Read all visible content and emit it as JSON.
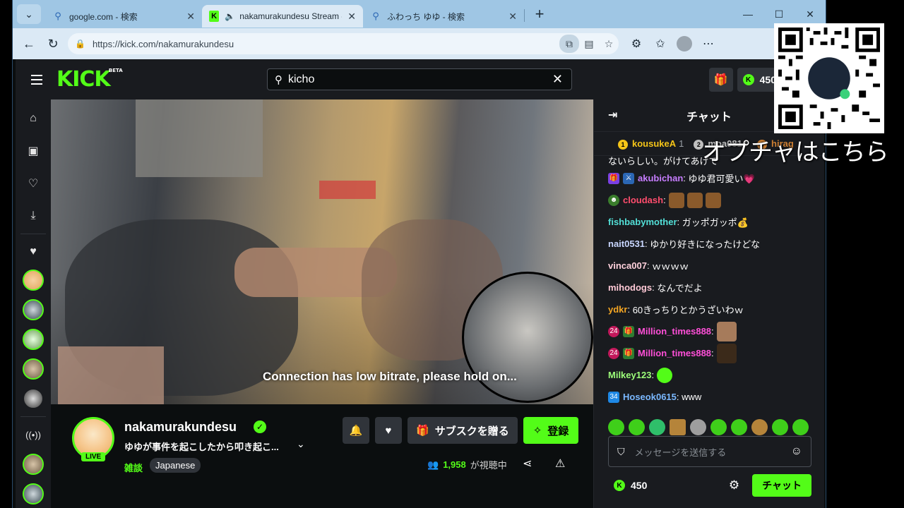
{
  "browser": {
    "tabs": [
      {
        "title": "google.com - 検索",
        "active": false
      },
      {
        "title": "nakamurakundesu Stream - W",
        "active": true
      },
      {
        "title": "ふわっち ゆゆ - 検索",
        "active": false
      }
    ],
    "url": "https://kick.com/nakamurakundesu"
  },
  "kick": {
    "logo": "KICK",
    "logo_beta": "BETA",
    "search_value": "kicho",
    "kicks_balance": "450"
  },
  "stream": {
    "status_overlay": "Connection has low bitrate, please hold on...",
    "streamer_name": "nakamurakundesu",
    "live_label": "LIVE",
    "title": "ゆゆが事件を起こしたから叩き起こ...",
    "category": "雑談",
    "tag": "Japanese",
    "sub_button": "サブスクを贈る",
    "follow_button": "登録",
    "viewer_count": "1,958",
    "viewer_label": "が視聴中"
  },
  "chat": {
    "header": "チャット",
    "leaderboard": [
      {
        "rank": "1",
        "name": "kousukeA",
        "count": "1"
      },
      {
        "rank": "2",
        "name": "moa0814",
        "count": ""
      },
      {
        "rank": "3",
        "name": "hirag",
        "count": ""
      }
    ],
    "partial_top": "ないらしい。がけてあげて",
    "messages": [
      {
        "user": "akubichan",
        "text": "ゆゆ君可愛い💗",
        "color": "#c77dff"
      },
      {
        "user": "cloudash",
        "text": "",
        "color": "#ff4d6d"
      },
      {
        "user": "fishbabymother",
        "text": "ガッポガッポ💰",
        "color": "#53e0d8"
      },
      {
        "user": "nait0531",
        "text": "ゆかり好きになったけどな",
        "color": "#c9d7ff"
      },
      {
        "user": "vinca007",
        "text": "ｗｗｗｗ",
        "color": "#ffd1dc"
      },
      {
        "user": "mihodogs",
        "text": "なんでだよ",
        "color": "#ffc9d6"
      },
      {
        "user": "ydkr",
        "text": "60きっちりとかうざいわｗ",
        "color": "#f5a623"
      },
      {
        "user": "Million_times888",
        "text": "",
        "color": "#ff4fd8"
      },
      {
        "user": "Million_times888",
        "text": "",
        "color": "#ff4fd8"
      },
      {
        "user": "Milkey123",
        "text": "",
        "color": "#9dff7a"
      },
      {
        "user": "Hoseok0615",
        "text": "www",
        "color": "#7ab8ff"
      }
    ],
    "input_placeholder": "メッセージを送信する",
    "kicks_balance": "450",
    "send_button": "チャット"
  },
  "overlay": {
    "text": "オプチャはこちら"
  }
}
